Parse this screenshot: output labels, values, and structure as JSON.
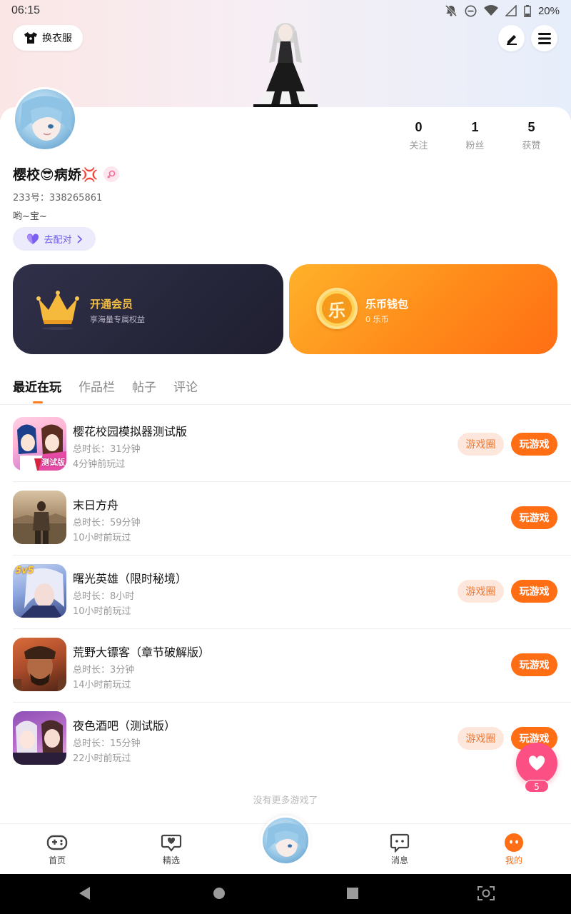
{
  "status_bar": {
    "time": "06:15",
    "battery": "20%"
  },
  "header": {
    "outfit_label": "换衣服",
    "edit_icon": "pencil-icon",
    "menu_icon": "hamburger-icon"
  },
  "profile": {
    "nickname": "樱校😎病娇💢",
    "user_id": "233号：338265861",
    "signature": "哟~宝~",
    "match_label": "去配对",
    "stats": [
      {
        "num": "0",
        "label": "关注"
      },
      {
        "num": "1",
        "label": "粉丝"
      },
      {
        "num": "5",
        "label": "获赞"
      }
    ]
  },
  "cards": {
    "vip": {
      "title": "开通会员",
      "subtitle": "享海量专属权益"
    },
    "wallet": {
      "title": "乐币钱包",
      "subtitle": "0 乐币",
      "coin_char": "乐"
    }
  },
  "tabs": [
    "最近在玩",
    "作品栏",
    "帖子",
    "评论"
  ],
  "games": [
    {
      "name": "樱花校园模拟器测试版",
      "duration": "总时长：31分钟",
      "last_played": "4分钟前玩过",
      "has_circle": true,
      "icon_label": "测试版"
    },
    {
      "name": "末日方舟",
      "duration": "总时长：59分钟",
      "last_played": "10小时前玩过",
      "has_circle": false,
      "icon_label": ""
    },
    {
      "name": "曙光英雄（限时秘境）",
      "duration": "总时长：8小时",
      "last_played": "10小时前玩过",
      "has_circle": true,
      "icon_label": "5v5"
    },
    {
      "name": "荒野大镖客（章节破解版）",
      "duration": "总时长：3分钟",
      "last_played": "14小时前玩过",
      "has_circle": false,
      "icon_label": ""
    },
    {
      "name": "夜色酒吧（测试版）",
      "duration": "总时长：15分钟",
      "last_played": "22小时前玩过",
      "has_circle": true,
      "icon_label": ""
    }
  ],
  "buttons": {
    "circle_label": "游戏圈",
    "play_label": "玩游戏"
  },
  "no_more_text": "没有更多游戏了",
  "float_like": {
    "count": "5"
  },
  "bottom_nav": [
    {
      "label": "首页",
      "icon": "gamepad-icon"
    },
    {
      "label": "精选",
      "icon": "heart-chat-icon"
    },
    {
      "label": "消息",
      "icon": "message-icon"
    },
    {
      "label": "我的",
      "icon": "profile-face-icon"
    }
  ],
  "colors": {
    "accent": "#ff6d14",
    "pink": "#fc4f83",
    "purple": "#6c5ce7"
  }
}
